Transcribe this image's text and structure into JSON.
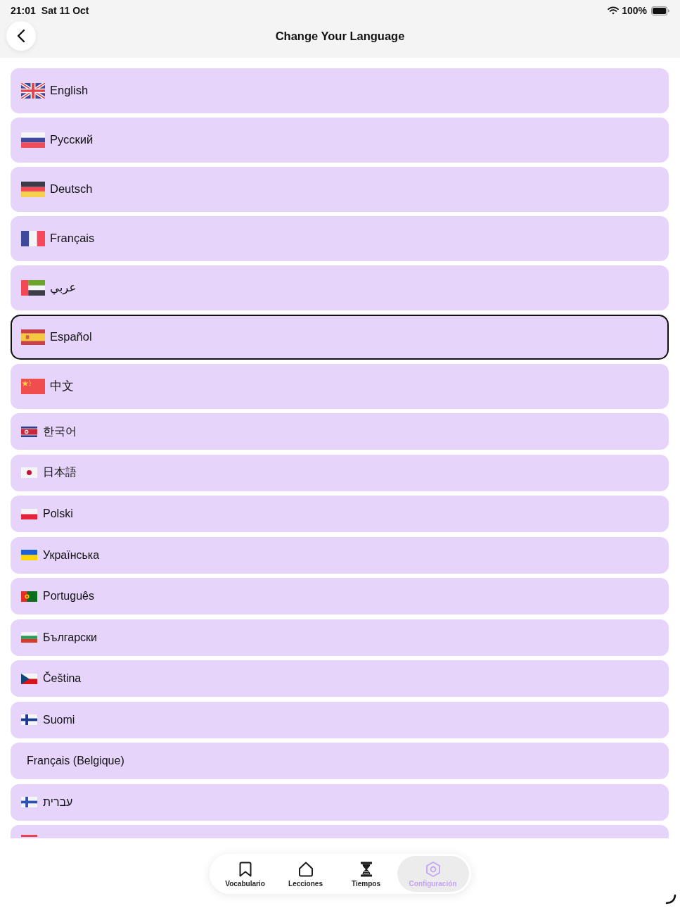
{
  "status_bar": {
    "time": "21:01",
    "date": "Sat 11 Oct",
    "battery": "100%"
  },
  "header": {
    "title": "Change Your Language"
  },
  "languages": [
    {
      "label": "English",
      "kind": "large",
      "selected": false,
      "cut": false
    },
    {
      "label": "Русский",
      "kind": "large",
      "selected": false,
      "cut": false
    },
    {
      "label": "Deutsch",
      "kind": "large",
      "selected": false,
      "cut": false
    },
    {
      "label": "Français",
      "kind": "large",
      "selected": false,
      "cut": false
    },
    {
      "label": "عربي",
      "kind": "large",
      "selected": false,
      "cut": false
    },
    {
      "label": "Español",
      "kind": "large",
      "selected": true,
      "cut": false
    },
    {
      "label": "中文",
      "kind": "large",
      "selected": false,
      "cut": false
    },
    {
      "label": "한국어",
      "kind": "compact",
      "selected": false,
      "cut": false
    },
    {
      "label": "日本語",
      "kind": "compact",
      "selected": false,
      "cut": false
    },
    {
      "label": "Polski",
      "kind": "compact",
      "selected": false,
      "cut": false
    },
    {
      "label": "Українська",
      "kind": "compact",
      "selected": false,
      "cut": false
    },
    {
      "label": "Português",
      "kind": "compact",
      "selected": false,
      "cut": false
    },
    {
      "label": "Български",
      "kind": "compact",
      "selected": false,
      "cut": false
    },
    {
      "label": "Čeština",
      "kind": "compact",
      "selected": false,
      "cut": false
    },
    {
      "label": "Suomi",
      "kind": "compact",
      "selected": false,
      "cut": false
    },
    {
      "label": "Français (Belgique)",
      "kind": "compact",
      "selected": false,
      "cut": false
    },
    {
      "label": "עברית",
      "kind": "compact",
      "selected": false,
      "cut": false
    },
    {
      "kind": "compact",
      "selected": false,
      "cut": true
    }
  ],
  "nav": [
    {
      "label": "Vocabulario",
      "selected": false
    },
    {
      "label": "Lecciones",
      "selected": false
    },
    {
      "label": "Tiempos",
      "selected": false
    },
    {
      "label": "Configuración",
      "selected": true
    }
  ]
}
